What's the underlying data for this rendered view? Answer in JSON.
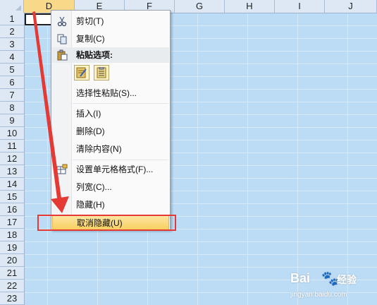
{
  "columns": [
    "D",
    "E",
    "F",
    "G",
    "H",
    "I",
    "J"
  ],
  "rows": [
    "1",
    "2",
    "3",
    "4",
    "5",
    "6",
    "7",
    "8",
    "9",
    "10",
    "11",
    "12",
    "13",
    "14",
    "15",
    "16",
    "17",
    "18",
    "19",
    "20",
    "21",
    "22",
    "23"
  ],
  "context_menu": {
    "cut": "剪切(T)",
    "copy": "复制(C)",
    "paste_options": "粘贴选项:",
    "paste_special": "选择性粘贴(S)...",
    "insert": "插入(I)",
    "delete": "删除(D)",
    "clear_contents": "清除内容(N)",
    "format_cells": "设置单元格格式(F)...",
    "column_width": "列宽(C)...",
    "hide": "隐藏(H)",
    "unhide": "取消隐藏(U)"
  },
  "icons": {
    "cut": "scissors-icon",
    "copy": "copy-icon",
    "paste": "clipboard-icon",
    "format": "format-cells-icon"
  },
  "colors": {
    "sheet_background": "#bcdcf6",
    "highlight_box": "#e53935",
    "arrow": "#e53935",
    "menu_highlight": "#f7cf61"
  },
  "watermark": {
    "logo": "Bai",
    "paw": "🐾",
    "brand": "经验",
    "url": "jingyan.baidu.com"
  }
}
